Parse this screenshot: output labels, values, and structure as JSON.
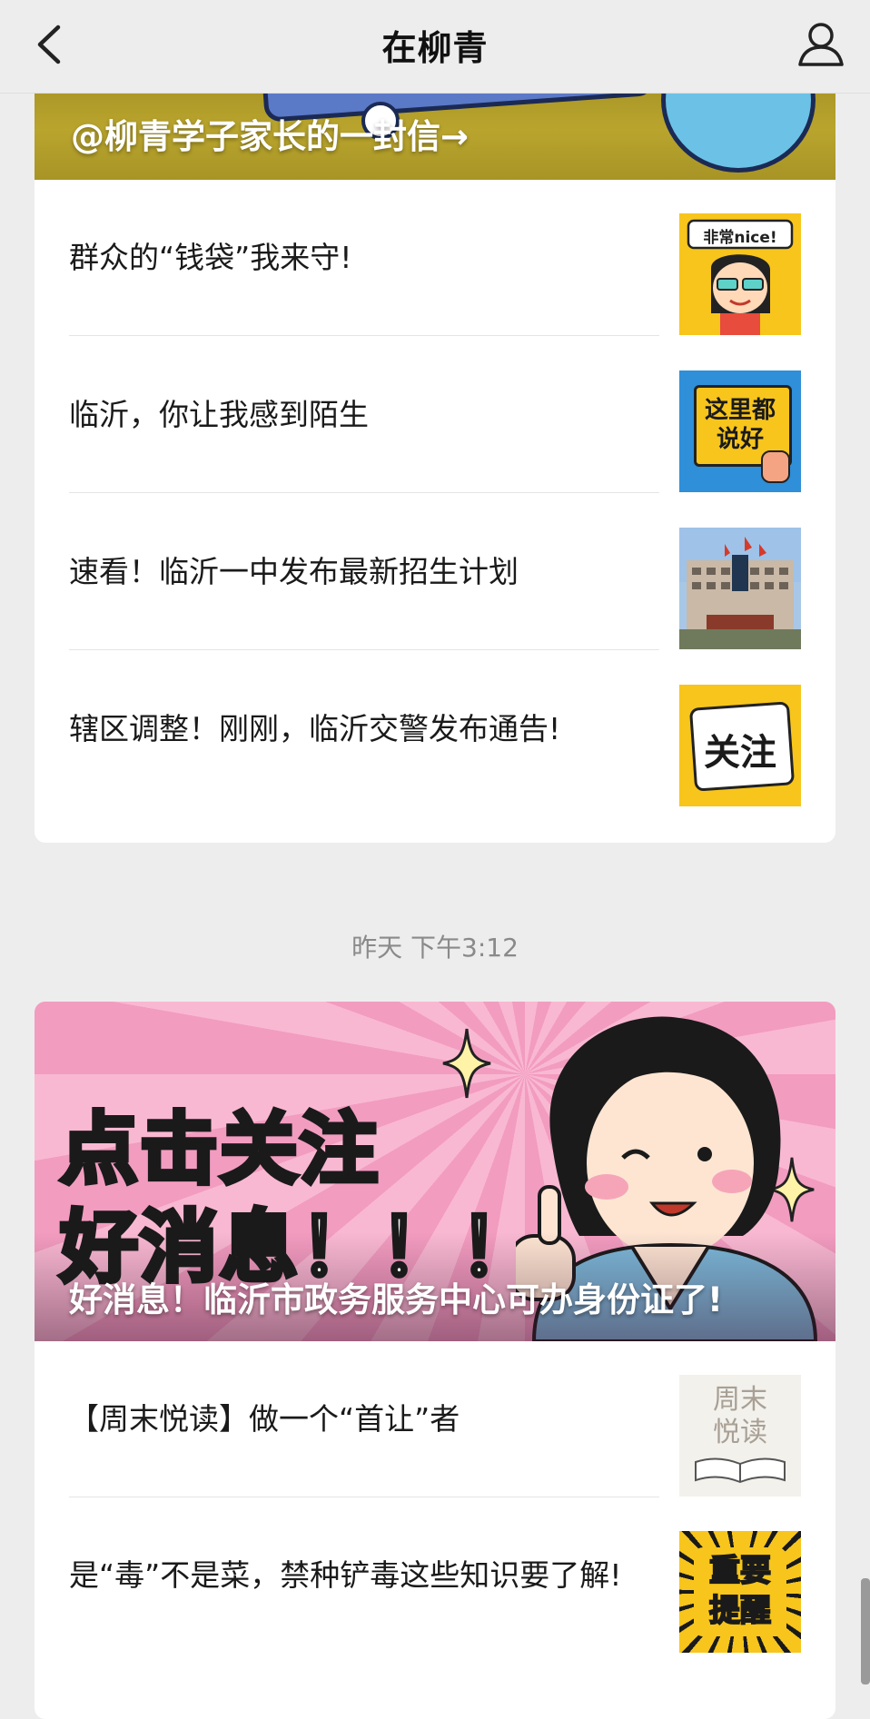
{
  "nav": {
    "title": "在柳青",
    "back_icon": "chevron-left-icon",
    "profile_icon": "user-icon"
  },
  "card1": {
    "banner_caption": "@柳青学子家长的一封信→",
    "items": [
      {
        "title": "群众的“钱袋”我来守!",
        "thumb_label": "非常nice!"
      },
      {
        "title": "临沂，你让我感到陌生",
        "thumb_label": "这里都说好"
      },
      {
        "title": "速看！临沂一中发布最新招生计划",
        "thumb_label": ""
      },
      {
        "title": "辖区调整！刚刚，临沂交警发布通告!",
        "thumb_label": "关注"
      }
    ]
  },
  "timestamp": "昨天 下午3:12",
  "card2": {
    "banner_big_line1": "点击关注",
    "banner_big_line2": "好消息！！！",
    "banner_caption": "好消息！临沂市政务服务中心可办身份证了!",
    "items": [
      {
        "title": "【周末悦读】做一个“首让”者",
        "thumb_label": "周末悦读"
      },
      {
        "title": "是“毒”不是菜，禁种铲毒这些知识要了解!",
        "thumb_label": "重要提醒"
      }
    ]
  },
  "colors": {
    "background": "#ededed",
    "card": "#ffffff",
    "banner1": "#b9a52d",
    "banner2": "#f7a8c6",
    "thumb_yellow": "#f7c51c"
  }
}
